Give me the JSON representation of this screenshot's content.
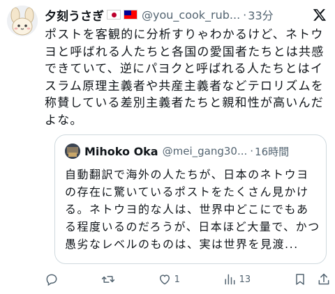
{
  "post": {
    "author_name": "夕刻うさぎ",
    "handle": "@you_cook_rub...",
    "separator": "·",
    "time": "33分",
    "text": "ポストを客観的に分析すりゃわかるけど、ネトウヨと呼ばれる人たちと各国の愛国者たちとは共感できていて、逆にパヨクと呼ばれる人たちとはイスラム原理主義者や共産主義者などテロリズムを称賛している差別主義者たちと親和性が高いんだよな。"
  },
  "quote": {
    "author_name": "Mihoko Oka",
    "handle": "@mei_gang30...",
    "separator": "·",
    "time": "16時間",
    "text": "自動翻訳で海外の人たちが、日本のネトウヨの存在に驚いているポストをたくさん見かける。ネトウヨ的な人は、世界中どこにでもある程度いるのだろうが、日本ほど大量で、かつ愚劣なレベルのものは、実は世界を見渡..."
  },
  "actions": {
    "likes": "1",
    "views": "13"
  }
}
